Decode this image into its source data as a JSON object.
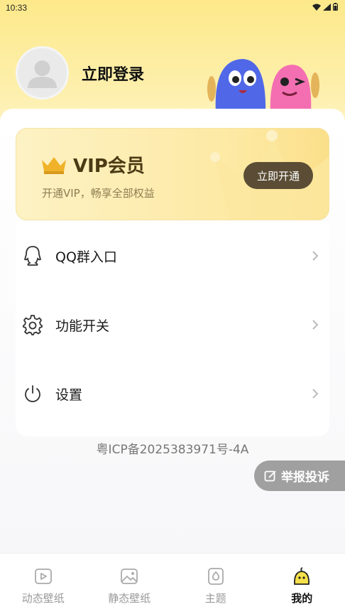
{
  "status_bar": {
    "time": "10:33"
  },
  "profile": {
    "login_label": "立即登录"
  },
  "vip": {
    "title": "VIP会员",
    "subtitle": "开通VIP，畅享全部权益",
    "button_label": "立即开通"
  },
  "menu": {
    "items": [
      {
        "label": "QQ群入口",
        "icon": "qq-icon"
      },
      {
        "label": "功能开关",
        "icon": "gear-icon"
      },
      {
        "label": "设置",
        "icon": "power-icon"
      }
    ]
  },
  "footer": {
    "icp": "粤ICP备2025383971号-4A"
  },
  "report": {
    "label": "举报投诉"
  },
  "tabs": [
    {
      "label": "动态壁纸",
      "icon": "video-icon",
      "active": false
    },
    {
      "label": "静态壁纸",
      "icon": "image-icon",
      "active": false
    },
    {
      "label": "主题",
      "icon": "theme-icon",
      "active": false
    },
    {
      "label": "我的",
      "icon": "mascot-icon",
      "active": true
    }
  ],
  "colors": {
    "accent": "#fde98a",
    "vip_button": "#5b4d35",
    "report_bg": "#a0a0a0"
  }
}
